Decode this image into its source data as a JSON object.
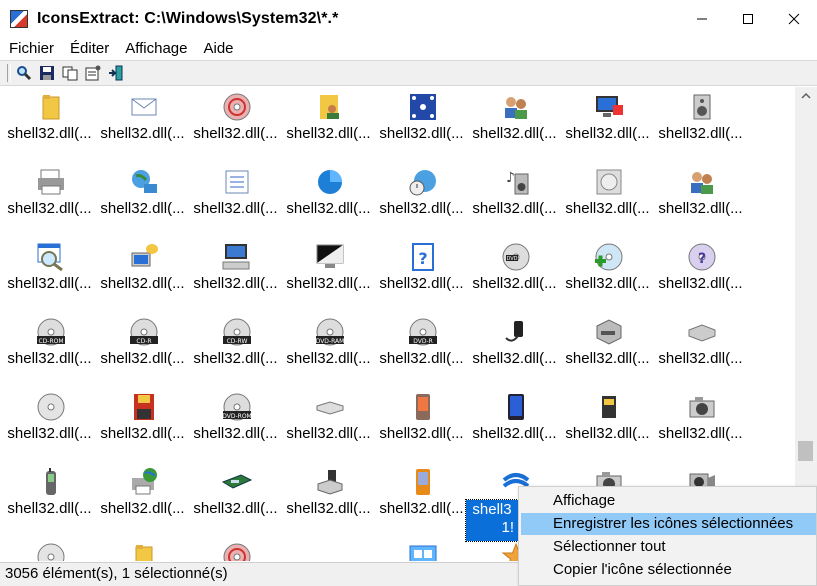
{
  "window": {
    "title": "IconsExtract:  C:\\Windows\\System32\\*.*"
  },
  "menu": [
    "Fichier",
    "Éditer",
    "Affichage",
    "Aide"
  ],
  "toolbar": {
    "buttons": [
      "search-icon",
      "save-icon",
      "copy-icon",
      "properties-icon",
      "exit-icon"
    ]
  },
  "grid": {
    "item_label": "shell32.dll(...",
    "selected_label_line1": "shell3",
    "selected_label_line2": "1!",
    "rows": [
      [
        "folder",
        "envelope",
        "disc-red",
        "folder-users",
        "network-grid",
        "users",
        "monitor-colors",
        "speaker-box"
      ],
      [
        "printer",
        "network-globe",
        "checklist",
        "pie-chart",
        "globe-clock",
        "music-speaker",
        "disc-box",
        "users"
      ],
      [
        "magnifier-window",
        "help-monitor",
        "keyboard-monitor",
        "monitor-dark",
        "help-doc",
        "dvd-drive",
        "disc-add",
        "help-disc"
      ],
      [
        "cd-rom",
        "cd-r",
        "cd-rw",
        "dvd-ram",
        "dvd-r",
        "media-player",
        "drive-box",
        "drive"
      ],
      [
        "disc",
        "floppy-red",
        "dvd-rom",
        "drive-slim",
        "pda",
        "pda-blue",
        "memory-card",
        "camera"
      ],
      [
        "phone",
        "printer-globe",
        "scanner",
        "media-drive",
        "pda-orange",
        "network-blue",
        "camera",
        "video-camera"
      ],
      [
        "disc",
        "folder",
        "disc-red",
        "",
        "window-blue",
        "star",
        "",
        ""
      ]
    ]
  },
  "status": {
    "text": "3056 élément(s), 1 sélectionné(s)"
  },
  "context_menu": {
    "items": [
      "Affichage",
      "Enregistrer les icônes sélectionnées",
      "Sélectionner tout",
      "Copier l'icône sélectionnée"
    ],
    "highlighted_index": 1
  }
}
